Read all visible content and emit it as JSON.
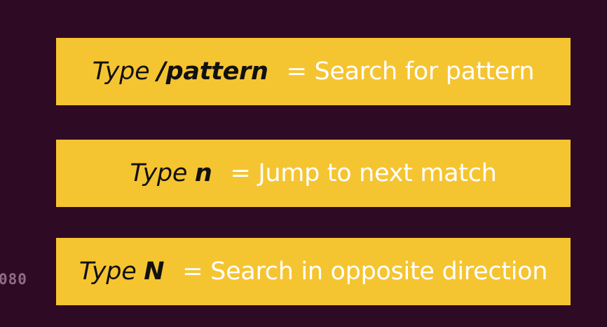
{
  "background_color": "#2f0a25",
  "card_color": "#f5c431",
  "side_code": "080",
  "cards": [
    {
      "prefix": "Type ",
      "key": "/pattern",
      "description": "= Search for pattern"
    },
    {
      "prefix": "Type ",
      "key": "n",
      "description": "= Jump to next match"
    },
    {
      "prefix": "Type ",
      "key": "N",
      "description": "= Search in opposite direction"
    }
  ]
}
